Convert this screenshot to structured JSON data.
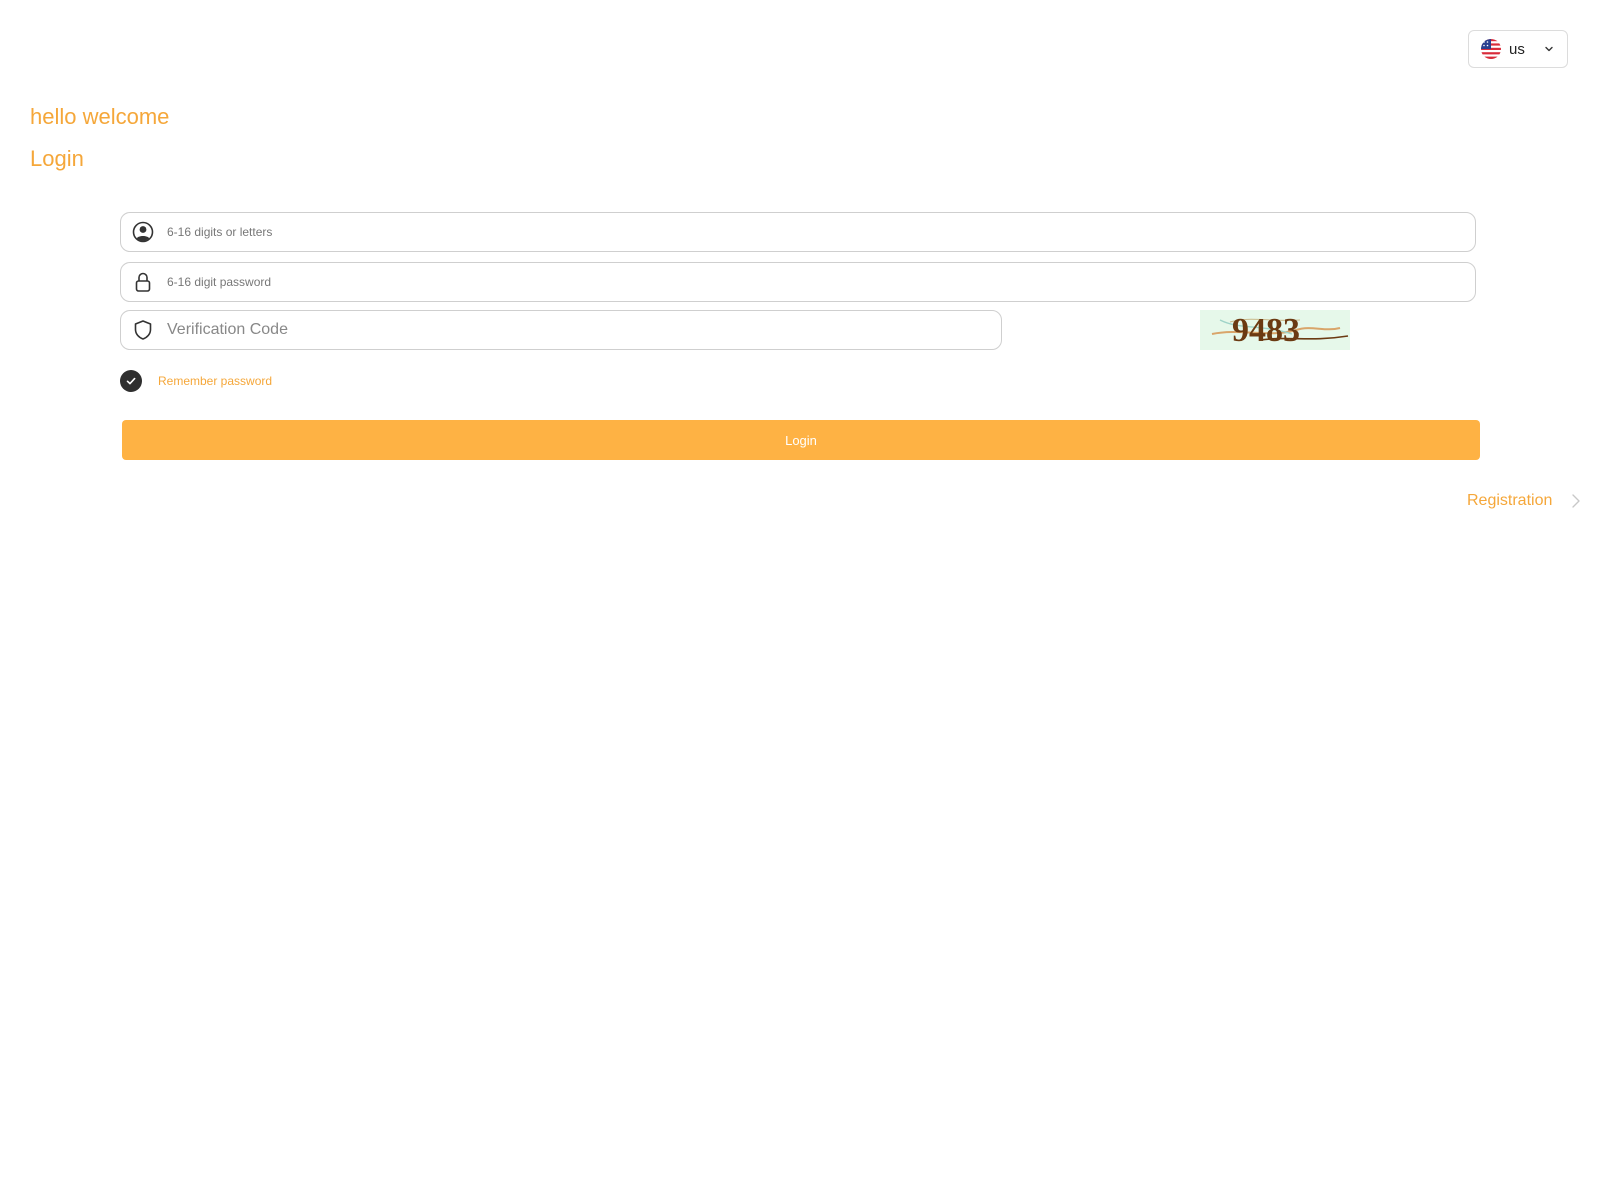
{
  "language": {
    "selected": "us",
    "flag_icon": "us-flag-icon"
  },
  "welcome": {
    "greeting": "hello welcome",
    "heading": "Login"
  },
  "form": {
    "username": {
      "placeholder": "6-16 digits or letters",
      "value": "",
      "icon": "user-icon"
    },
    "password": {
      "placeholder": "6-16 digit password",
      "value": "",
      "icon": "lock-icon"
    },
    "verification": {
      "placeholder": "Verification Code",
      "value": "",
      "icon": "shield-icon"
    },
    "captcha_text": "9483",
    "remember_password": {
      "label": "Remember password",
      "checked": true
    },
    "login_button_label": "Login"
  },
  "registration": {
    "label": "Registration"
  },
  "colors": {
    "accent": "#f5a73a",
    "button": "#feb244",
    "check": "#2f2f2f",
    "captcha_bg": "#e6f8ea",
    "captcha_text": "#6b3a12"
  }
}
